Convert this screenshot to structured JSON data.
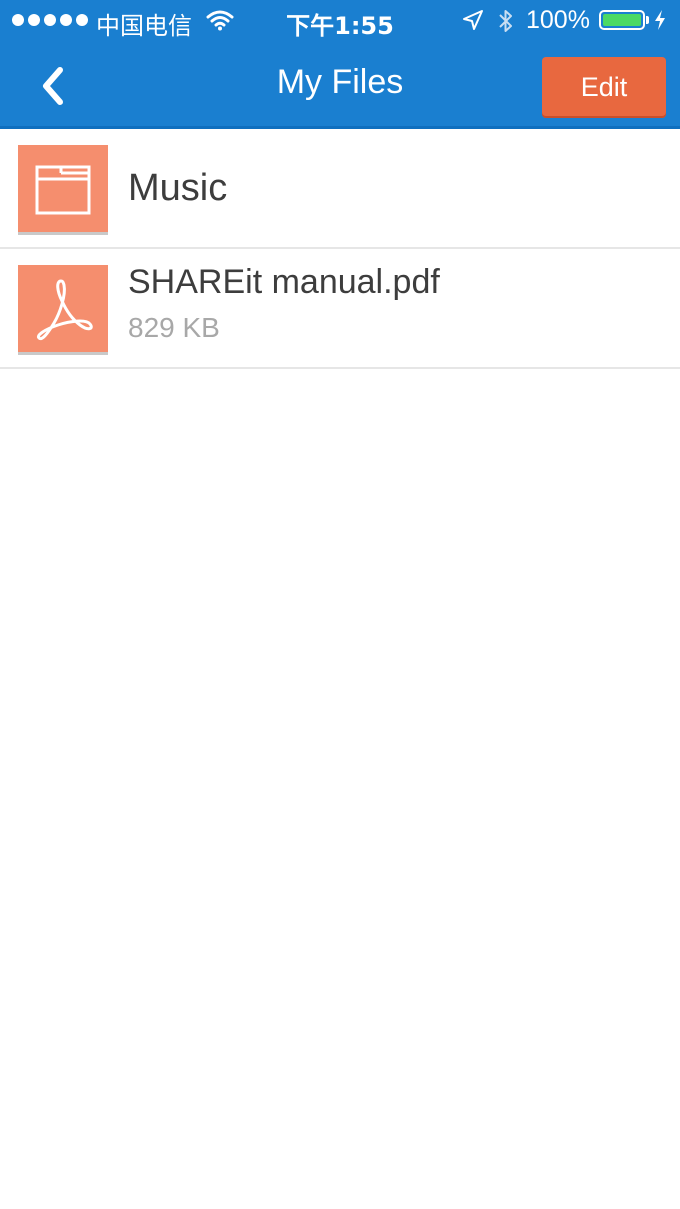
{
  "status_bar": {
    "carrier": "中国电信",
    "time": "下午1:55",
    "battery_percent": "100%",
    "battery_level": 1.0,
    "icons": [
      "signal-dots-icon",
      "wifi-icon",
      "location-arrow-icon",
      "bluetooth-icon",
      "battery-icon",
      "charging-bolt-icon"
    ]
  },
  "nav": {
    "title": "My Files",
    "back_icon": "chevron-left-icon",
    "edit_label": "Edit"
  },
  "files": [
    {
      "name": "Music",
      "type": "folder",
      "icon": "folder-icon"
    },
    {
      "name": "SHAREit manual.pdf",
      "type": "pdf",
      "size": "829 KB",
      "icon": "pdf-acrobat-icon"
    }
  ],
  "colors": {
    "header_bg": "#1a7fd0",
    "edit_button_bg": "#e8683f",
    "thumb_bg": "#f58e6e",
    "battery_fill": "#4cd964"
  }
}
